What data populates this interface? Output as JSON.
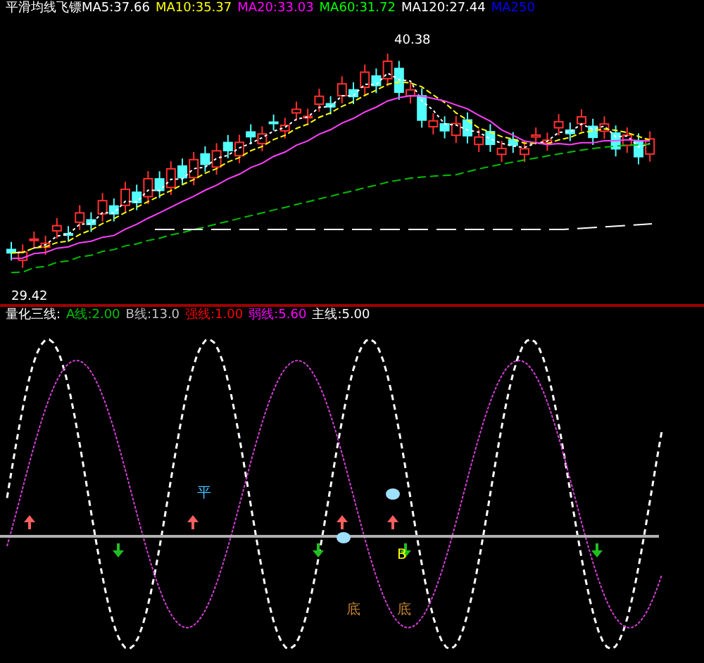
{
  "price_panel": {
    "legend": [
      {
        "text": "平滑均线飞镖MA5:37.66",
        "color": "#ffffff"
      },
      {
        "text": "MA10:35.37",
        "color": "#ffff00"
      },
      {
        "text": "MA20:33.03",
        "color": "#ff00ff"
      },
      {
        "text": "MA60:31.72",
        "color": "#00ff00"
      },
      {
        "text": "MA120:27.44",
        "color": "#ffffff"
      },
      {
        "text": "MA250",
        "color": "#0000ff"
      }
    ],
    "high_label": "40.38",
    "low_label": "29.42"
  },
  "indicator_panel": {
    "legend": [
      {
        "text": "量化三线:",
        "color": "#ffffff"
      },
      {
        "text": "A线:2.00",
        "color": "#00c000"
      },
      {
        "text": "B线:13.0",
        "color": "#c0c0c0"
      },
      {
        "text": "强线:1.00",
        "color": "#ff0000"
      },
      {
        "text": "弱线:5.60",
        "color": "#ff00ff"
      },
      {
        "text": "主线:5.00",
        "color": "#ffffff"
      }
    ],
    "signals": [
      {
        "kind": "buy"
      },
      {
        "kind": "buy"
      },
      {
        "kind": "buy"
      },
      {
        "kind": "buy"
      },
      {
        "kind": "sell"
      },
      {
        "kind": "sell"
      },
      {
        "kind": "sell"
      },
      {
        "kind": "sell"
      }
    ],
    "labels": [
      {
        "text": "平",
        "color": "#40c0ff"
      },
      {
        "text": "B",
        "color": "#ffff00"
      },
      {
        "text": "底",
        "color": "#c08030"
      },
      {
        "text": "底",
        "color": "#c08030"
      }
    ]
  }
}
